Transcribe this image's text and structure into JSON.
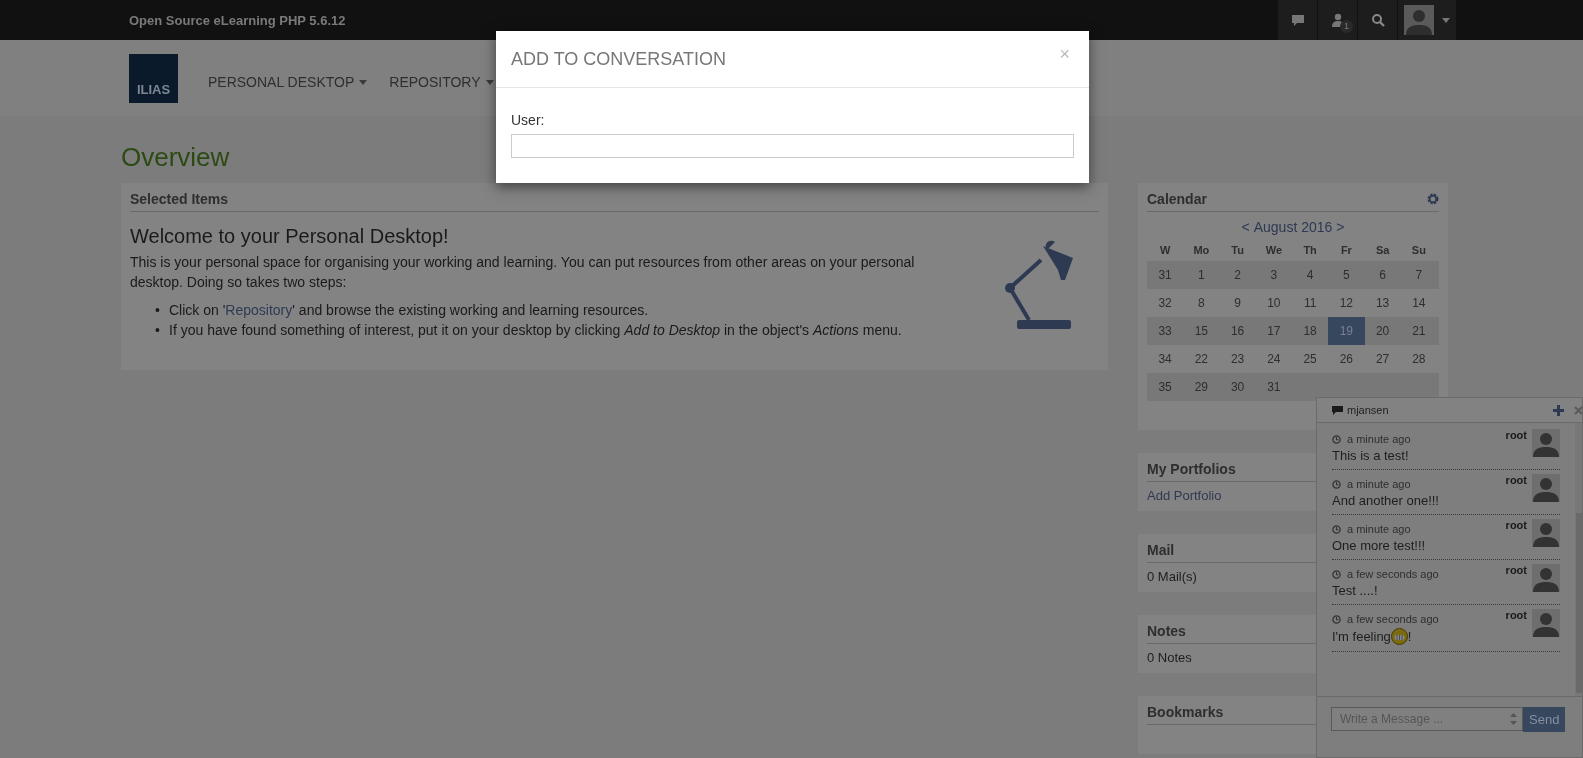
{
  "topbar": {
    "title": "Open Source eLearning PHP 5.6.12",
    "badge": "1"
  },
  "header": {
    "logo": "ILIAS",
    "nav": [
      {
        "label": "PERSONAL DESKTOP"
      },
      {
        "label": "REPOSITORY"
      }
    ]
  },
  "page_title": "Overview",
  "selected_items": {
    "title": "Selected Items",
    "heading": "Welcome to your Personal Desktop!",
    "intro": "This is your personal space for organising your working and learning. You can put resources from other areas on your personal desktop. Doing so takes two steps:",
    "steps": [
      {
        "kind": "link",
        "marker": "•",
        "before": "Click on '",
        "link": "Repository",
        "after": "' and browse the existing working and learning resources."
      },
      {
        "kind": "text",
        "marker": "•",
        "text": "If you have found something of interest, put it on your desktop by clicking *Add to Desktop* in the object's *Actions* menu."
      }
    ]
  },
  "calendar": {
    "title": "Calendar",
    "prev": "<",
    "month": "August 2016",
    "next": ">",
    "headers": [
      "W",
      "Mo",
      "Tu",
      "We",
      "Th",
      "Fr",
      "Sa",
      "Su"
    ],
    "weeks": [
      {
        "week": "31",
        "days": [
          {
            "day": "1",
            "selected": false
          },
          {
            "day": "2",
            "selected": false
          },
          {
            "day": "3",
            "selected": false
          },
          {
            "day": "4",
            "selected": false
          },
          {
            "day": "5",
            "selected": false
          },
          {
            "day": "6",
            "selected": false
          },
          {
            "day": "7",
            "selected": false
          }
        ]
      },
      {
        "week": "32",
        "days": [
          {
            "day": "8",
            "selected": false
          },
          {
            "day": "9",
            "selected": false
          },
          {
            "day": "10",
            "selected": false
          },
          {
            "day": "11",
            "selected": false
          },
          {
            "day": "12",
            "selected": false
          },
          {
            "day": "13",
            "selected": false
          },
          {
            "day": "14",
            "selected": false
          }
        ]
      },
      {
        "week": "33",
        "days": [
          {
            "day": "15",
            "selected": false
          },
          {
            "day": "16",
            "selected": false
          },
          {
            "day": "17",
            "selected": false
          },
          {
            "day": "18",
            "selected": false
          },
          {
            "day": "19",
            "selected": true
          },
          {
            "day": "20",
            "selected": false
          },
          {
            "day": "21",
            "selected": false
          }
        ]
      },
      {
        "week": "34",
        "days": [
          {
            "day": "22",
            "selected": false
          },
          {
            "day": "23",
            "selected": false
          },
          {
            "day": "24",
            "selected": false
          },
          {
            "day": "25",
            "selected": false
          },
          {
            "day": "26",
            "selected": false
          },
          {
            "day": "27",
            "selected": false
          },
          {
            "day": "28",
            "selected": false
          }
        ]
      },
      {
        "week": "35",
        "days": [
          {
            "day": "29",
            "selected": false
          },
          {
            "day": "30",
            "selected": false
          },
          {
            "day": "31",
            "selected": false
          }
        ]
      }
    ]
  },
  "blocks": [
    {
      "title": "My Portfolios",
      "kind": "link",
      "content": "Add Portfolio"
    },
    {
      "title": "Mail",
      "kind": "text",
      "content": "0 Mail(s)"
    },
    {
      "title": "Notes",
      "kind": "text",
      "content": "0 Notes"
    },
    {
      "title": "Bookmarks"
    }
  ],
  "chat": {
    "title": "mjansen",
    "messages": [
      {
        "time": "a minute ago",
        "author": "root",
        "text": "This is a test!",
        "emoji": false
      },
      {
        "time": "a minute ago",
        "author": "root",
        "text": "And another one!!!",
        "emoji": false
      },
      {
        "time": "a minute ago",
        "author": "root",
        "text": "One more test!!!",
        "emoji": false
      },
      {
        "time": "a few seconds ago",
        "author": "root",
        "text": "Test ....!",
        "emoji": false
      },
      {
        "time": "a few seconds ago",
        "author": "root",
        "text": "I'm feeling",
        "emoji": true,
        "after": "!"
      }
    ],
    "placeholder": "Write a Message ...",
    "send": "Send"
  },
  "modal": {
    "title": "ADD TO CONVERSATION",
    "close": "×",
    "label": "User:"
  }
}
